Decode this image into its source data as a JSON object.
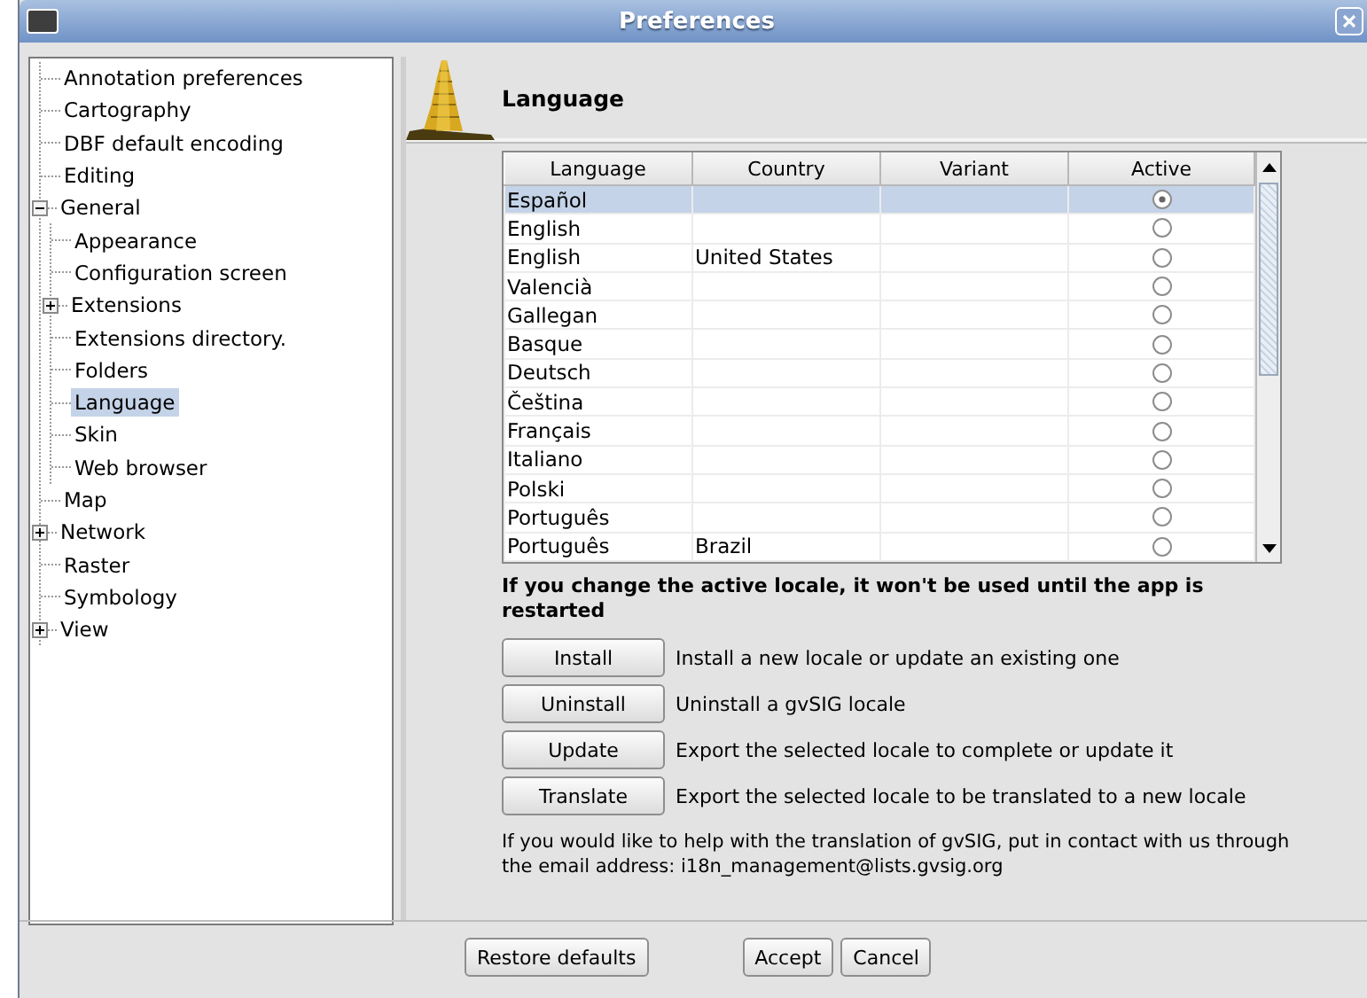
{
  "window": {
    "title": "Preferences"
  },
  "tree": [
    {
      "label": "Annotation preferences",
      "selected": false
    },
    {
      "label": "Cartography",
      "selected": false
    },
    {
      "label": "DBF default encoding",
      "selected": false
    },
    {
      "label": "Editing",
      "selected": false
    },
    {
      "label": "General",
      "selected": false,
      "expanded": true,
      "children": [
        {
          "label": "Appearance",
          "selected": false
        },
        {
          "label": "Configuration screen",
          "selected": false
        },
        {
          "label": "Extensions",
          "selected": false,
          "expanded": false
        },
        {
          "label": "Extensions directory.",
          "selected": false
        },
        {
          "label": "Folders",
          "selected": false
        },
        {
          "label": "Language",
          "selected": true
        },
        {
          "label": "Skin",
          "selected": false
        },
        {
          "label": "Web browser",
          "selected": false
        }
      ]
    },
    {
      "label": "Map",
      "selected": false
    },
    {
      "label": "Network",
      "selected": false,
      "expanded": false
    },
    {
      "label": "Raster",
      "selected": false
    },
    {
      "label": "Symbology",
      "selected": false
    },
    {
      "label": "View",
      "selected": false,
      "expanded": false
    }
  ],
  "page": {
    "title": "Language",
    "table": {
      "columns": [
        "Language",
        "Country",
        "Variant",
        "Active"
      ],
      "rows": [
        {
          "language": "Español",
          "country": "",
          "variant": "",
          "active": true,
          "selected": true
        },
        {
          "language": "English",
          "country": "",
          "variant": "",
          "active": false,
          "selected": false
        },
        {
          "language": "English",
          "country": "United States",
          "variant": "",
          "active": false,
          "selected": false
        },
        {
          "language": "Valencià",
          "country": "",
          "variant": "",
          "active": false,
          "selected": false
        },
        {
          "language": "Gallegan",
          "country": "",
          "variant": "",
          "active": false,
          "selected": false
        },
        {
          "language": "Basque",
          "country": "",
          "variant": "",
          "active": false,
          "selected": false
        },
        {
          "language": "Deutsch",
          "country": "",
          "variant": "",
          "active": false,
          "selected": false
        },
        {
          "language": "Čeština",
          "country": "",
          "variant": "",
          "active": false,
          "selected": false
        },
        {
          "language": "Français",
          "country": "",
          "variant": "",
          "active": false,
          "selected": false
        },
        {
          "language": "Italiano",
          "country": "",
          "variant": "",
          "active": false,
          "selected": false
        },
        {
          "language": "Polski",
          "country": "",
          "variant": "",
          "active": false,
          "selected": false
        },
        {
          "language": "Português",
          "country": "",
          "variant": "",
          "active": false,
          "selected": false
        },
        {
          "language": "Português",
          "country": "Brazil",
          "variant": "",
          "active": false,
          "selected": false
        }
      ]
    },
    "warning": "If you change the active locale, it won't be used until the app is restarted",
    "actions": [
      {
        "button": "Install",
        "description": "Install a new locale or update an existing one"
      },
      {
        "button": "Uninstall",
        "description": "Uninstall a gvSIG locale"
      },
      {
        "button": "Update",
        "description": "Export the selected locale to complete or update it"
      },
      {
        "button": "Translate",
        "description": "Export the selected locale to be translated to a new locale"
      }
    ],
    "note": "If you would like to help with the translation of gvSIG, put in contact with us through the email address: i18n_management@lists.gvsig.org"
  },
  "buttons": {
    "restore": "Restore defaults",
    "dialog": [
      "Accept",
      "Cancel"
    ]
  }
}
